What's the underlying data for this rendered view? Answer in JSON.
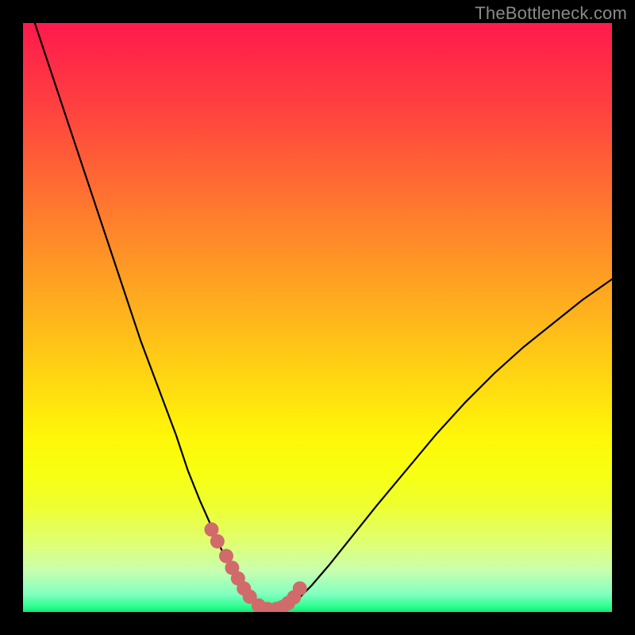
{
  "watermark": "TheBottleneck.com",
  "colors": {
    "frame": "#000000",
    "curve": "#000000",
    "marker": "#d16a6a",
    "gradient_top": "#ff1a4d",
    "gradient_bottom": "#10e878"
  },
  "chart_data": {
    "type": "line",
    "title": "",
    "xlabel": "",
    "ylabel": "",
    "xlim": [
      0,
      100
    ],
    "ylim": [
      0,
      100
    ],
    "series": [
      {
        "name": "bottleneck-curve",
        "x": [
          2,
          5,
          8,
          11,
          14,
          17,
          20,
          23,
          26,
          28,
          30,
          32,
          33.5,
          35,
          36,
          37,
          38,
          39,
          40,
          41,
          42,
          43,
          44,
          45.5,
          47,
          49,
          52,
          56,
          60,
          65,
          70,
          75,
          80,
          85,
          90,
          95,
          100
        ],
        "values": [
          100,
          91,
          82,
          73,
          64,
          55,
          46,
          38,
          30,
          24,
          19,
          14.5,
          11,
          8,
          6,
          4.3,
          3,
          1.9,
          1.2,
          0.7,
          0.5,
          0.5,
          0.7,
          1.3,
          2.5,
          4.5,
          8,
          13,
          18,
          24,
          30,
          35.5,
          40.5,
          45,
          49,
          53,
          56.5
        ]
      }
    ],
    "markers": {
      "name": "highlighted-points",
      "x": [
        32,
        33,
        34.5,
        35.5,
        36.5,
        37.5,
        38.5,
        40,
        41.5,
        43,
        44,
        45,
        46,
        47
      ],
      "values": [
        14,
        12,
        9.5,
        7.5,
        5.7,
        4.0,
        2.6,
        1.1,
        0.5,
        0.5,
        0.8,
        1.5,
        2.5,
        4.0
      ]
    }
  }
}
